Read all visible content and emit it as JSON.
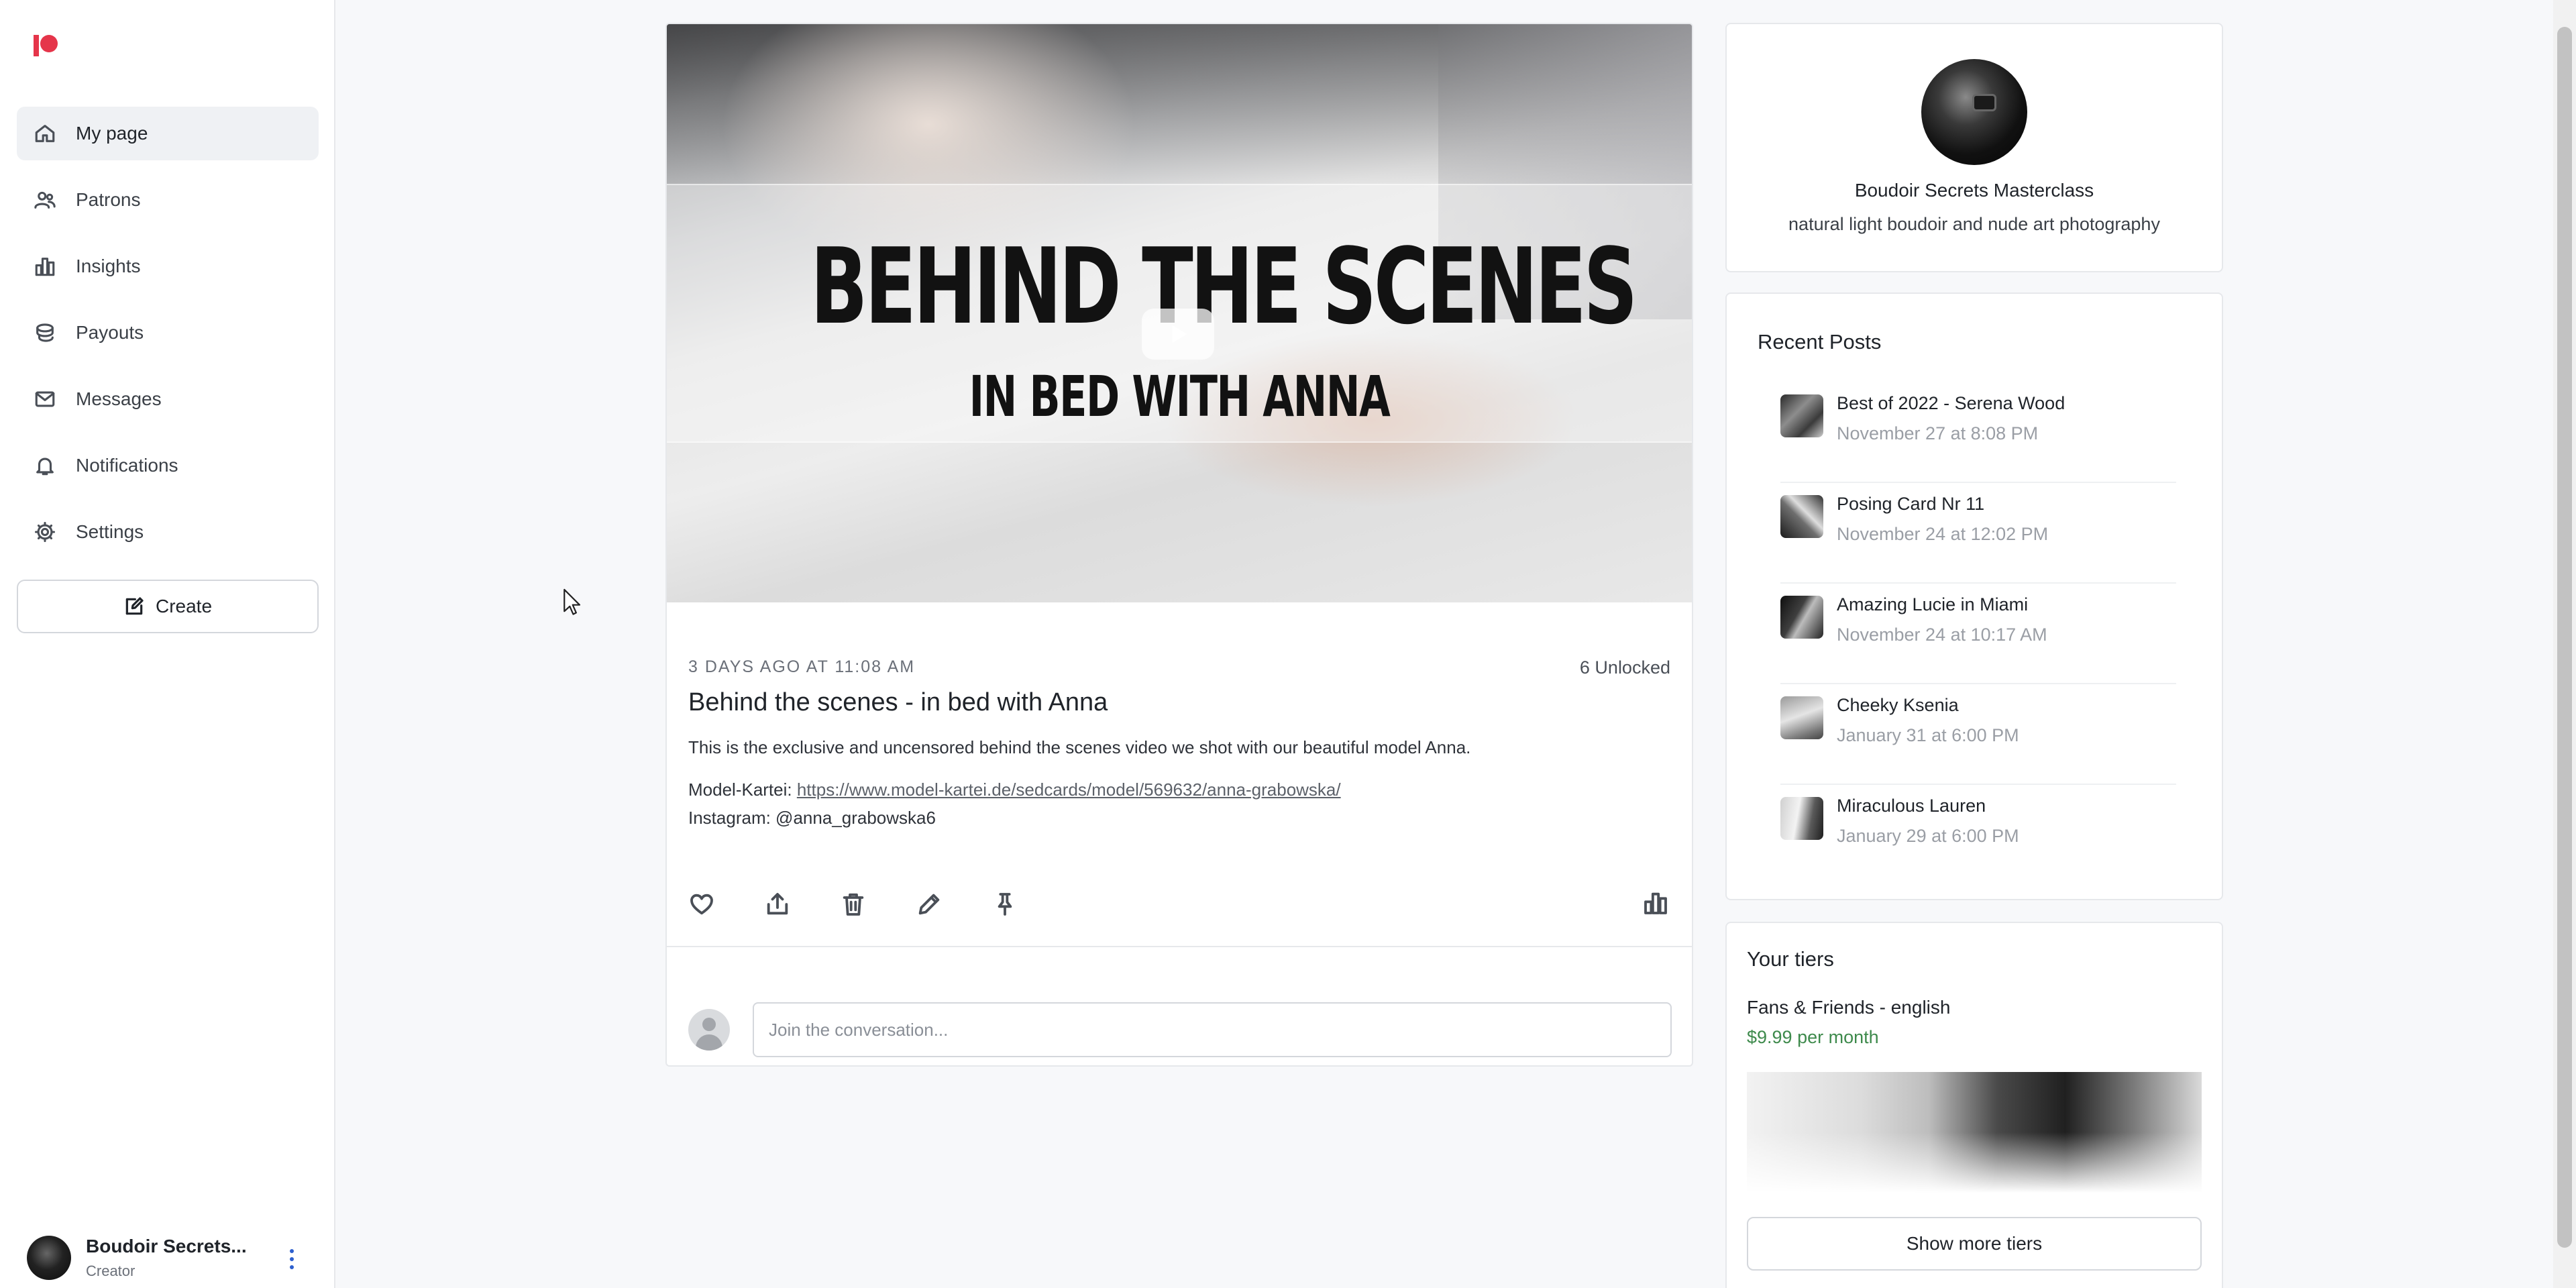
{
  "sidebar": {
    "logo": "patreon-logo",
    "items": [
      {
        "label": "My page",
        "icon": "home-icon",
        "active": true
      },
      {
        "label": "Patrons",
        "icon": "users-icon"
      },
      {
        "label": "Insights",
        "icon": "chart-icon"
      },
      {
        "label": "Payouts",
        "icon": "coins-icon"
      },
      {
        "label": "Messages",
        "icon": "mail-icon"
      },
      {
        "label": "Notifications",
        "icon": "bell-icon"
      },
      {
        "label": "Settings",
        "icon": "gear-icon"
      }
    ],
    "create_label": "Create",
    "profile": {
      "name": "Boudoir Secrets...",
      "role": "Creator"
    }
  },
  "post": {
    "video_title": "BEHIND THE SCENES",
    "video_subtitle": "IN BED WITH ANNA",
    "meta": "3 DAYS AGO AT 11:08 AM",
    "unlocked": "6 Unlocked",
    "title": "Behind the scenes - in bed with Anna",
    "body": "This is the exclusive and uncensored behind the scenes video we shot with our beautiful model Anna.",
    "model_label": "Model-Kartei: ",
    "model_link": "https://www.model-kartei.de/sedcards/model/569632/anna-grabowska/",
    "instagram": "Instagram: @anna_grabowska6",
    "comment_placeholder": "Join the conversation..."
  },
  "creator": {
    "name": "Boudoir Secrets Masterclass",
    "description": "natural light boudoir and nude art photography"
  },
  "recent": {
    "title": "Recent Posts",
    "items": [
      {
        "name": "Best of 2022 - Serena Wood",
        "date": "November 27 at 8:08 PM"
      },
      {
        "name": "Posing Card Nr 11",
        "date": "November 24 at 12:02 PM"
      },
      {
        "name": "Amazing Lucie in Miami",
        "date": "November 24 at 10:17 AM"
      },
      {
        "name": "Cheeky Ksenia",
        "date": "January 31 at 6:00 PM"
      },
      {
        "name": "Miraculous Lauren",
        "date": "January 29 at 6:00 PM"
      }
    ]
  },
  "tiers": {
    "title": "Your tiers",
    "tier_name": "Fans & Friends - english",
    "tier_price": "$9.99 per month",
    "show_more_label": "Show more tiers"
  },
  "colors": {
    "brand": "#e5354a",
    "link": "#5c6169",
    "price": "#3e8a4c",
    "kebab": "#2d5fce"
  }
}
